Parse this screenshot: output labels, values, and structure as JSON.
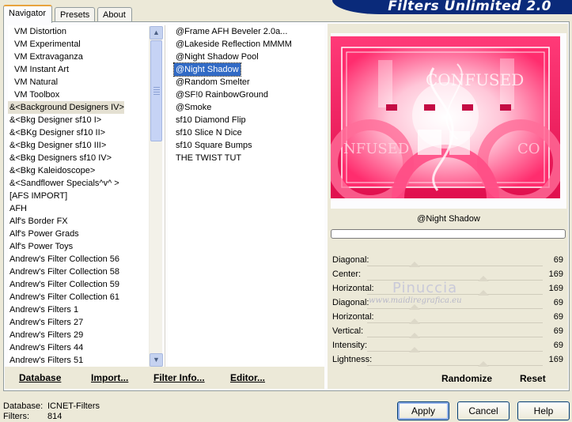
{
  "app": {
    "banner_title": "Filters Unlimited 2.0"
  },
  "tabs": [
    {
      "label": "Navigator",
      "active": true
    },
    {
      "label": "Presets",
      "active": false
    },
    {
      "label": "About",
      "active": false
    }
  ],
  "categories": [
    "VM Distortion",
    "VM Experimental",
    "VM Extravaganza",
    "VM Instant Art",
    "VM Natural",
    "VM Toolbox",
    "&<Background Designers IV>",
    "&<Bkg Designer sf10 I>",
    "&<BKg Designer sf10 II>",
    "&<Bkg Designer sf10 III>",
    "&<Bkg Designers sf10 IV>",
    "&<Bkg Kaleidoscope>",
    "&<Sandflower Specials^v^ >",
    "[AFS IMPORT]",
    "AFH",
    "Alf's Border FX",
    "Alf's Power Grads",
    "Alf's Power Toys",
    "Andrew's Filter Collection 56",
    "Andrew's Filter Collection 58",
    "Andrew's Filter Collection 59",
    "Andrew's Filter Collection 61",
    "Andrew's Filters 1",
    "Andrew's Filters 27",
    "Andrew's Filters 29",
    "Andrew's Filters 44",
    "Andrew's Filters 51"
  ],
  "selected_category_index": 6,
  "filters": [
    "@Frame AFH Beveler 2.0a...",
    "@Lakeside Reflection MMMM",
    "@Night Shadow Pool",
    "@Night Shadow",
    "@Random Smelter",
    "@SF!0 RainbowGround",
    "@Smoke",
    "sf10 Diamond Flip",
    "sf10 Slice N Dice",
    "sf10 Square Bumps",
    "THE TWIST TUT"
  ],
  "selected_filter_index": 3,
  "preview": {
    "filter_name": "@Night Shadow",
    "image_text_1": "CONFUSED",
    "image_text_2": "NFUSED",
    "image_text_3": "CO",
    "accent": "#ff2d6e"
  },
  "parameters": [
    {
      "label": "Diagonal:",
      "value": "69",
      "level": 0.27
    },
    {
      "label": "Center:",
      "value": "169",
      "level": 0.66
    },
    {
      "label": "Horizontal:",
      "value": "169",
      "level": 0.66
    },
    {
      "label": "Diagonal:",
      "value": "69",
      "level": 0.27
    },
    {
      "label": "Horizontal:",
      "value": "69",
      "level": 0.27
    },
    {
      "label": "Vertical:",
      "value": "69",
      "level": 0.27
    },
    {
      "label": "Intensity:",
      "value": "69",
      "level": 0.27
    },
    {
      "label": "Lightness:",
      "value": "169",
      "level": 0.66
    }
  ],
  "watermark": {
    "line1": "Pinuccia",
    "line2": "www.maidiregrafica.eu"
  },
  "toolbar": {
    "database": "Database",
    "import": "Import...",
    "filter_info": "Filter Info...",
    "editor": "Editor...",
    "randomize": "Randomize",
    "reset": "Reset"
  },
  "footer": {
    "database_label": "Database:",
    "database_value": "ICNET-Filters",
    "filters_label": "Filters:",
    "filters_value": "814"
  },
  "buttons": {
    "apply": "Apply",
    "cancel": "Cancel",
    "help": "Help"
  }
}
